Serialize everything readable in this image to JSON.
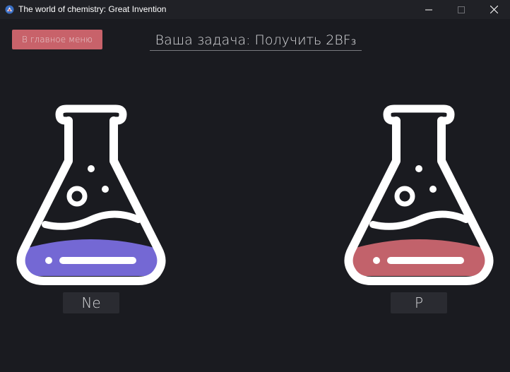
{
  "window": {
    "title": "The world of chemistry: Great Invention"
  },
  "header": {
    "menu_button_label": "В главное меню",
    "task_text": "Ваша задача: Получить 2BF₃"
  },
  "flasks": [
    {
      "element": "Ne",
      "liquid_color": "#7468d4",
      "icon": "erlenmeyer-flask-icon"
    },
    {
      "element": "P",
      "liquid_color": "#c2626b",
      "icon": "erlenmeyer-flask-icon"
    }
  ],
  "colors": {
    "background": "#1a1b20",
    "titlebar": "#202126",
    "accent_button": "#c8626a",
    "flask_outline": "#ffffff"
  }
}
